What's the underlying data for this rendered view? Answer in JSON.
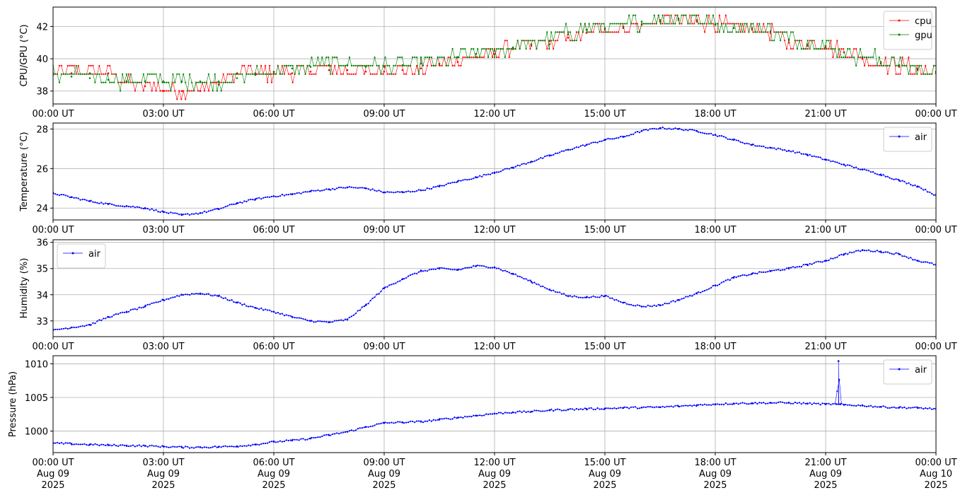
{
  "chart_data": [
    {
      "type": "line",
      "id": "cpu_gpu",
      "ylabel": "CPU/GPU (°C)",
      "xlim": [
        0,
        24
      ],
      "ylim": [
        37.2,
        43.2
      ],
      "yticks": [
        38,
        40,
        42
      ],
      "x_ticks": [
        0,
        3,
        6,
        9,
        12,
        15,
        18,
        21,
        24
      ],
      "x_tick_labels": [
        "00:00 UT",
        "03:00 UT",
        "06:00 UT",
        "09:00 UT",
        "12:00 UT",
        "15:00 UT",
        "18:00 UT",
        "21:00 UT",
        "00:00 UT"
      ],
      "grid": true,
      "legend": "top-right",
      "series": [
        {
          "name": "cpu",
          "color": "#ff0000",
          "marker": "dot",
          "x": [
            0,
            0.5,
            1,
            1.5,
            2,
            2.5,
            3,
            3.5,
            4,
            4.5,
            5,
            5.5,
            6,
            6.5,
            7,
            7.5,
            8,
            8.5,
            9,
            9.5,
            10,
            10.5,
            11,
            11.5,
            12,
            12.5,
            13,
            13.5,
            14,
            14.5,
            15,
            15.5,
            16,
            16.5,
            17,
            17.5,
            18,
            18.5,
            19,
            19.5,
            20,
            20.5,
            21,
            21.5,
            22,
            22.5,
            23,
            23.5,
            24
          ],
          "values": [
            39.1,
            39.1,
            39.1,
            39.1,
            38.6,
            38.3,
            38.0,
            38.0,
            38.0,
            38.4,
            39.1,
            39.1,
            39.1,
            39.1,
            39.2,
            39.3,
            39.3,
            39.2,
            39.2,
            39.3,
            39.4,
            39.6,
            39.8,
            40.1,
            40.3,
            40.6,
            40.8,
            40.9,
            41.3,
            41.6,
            41.8,
            41.9,
            42.1,
            42.3,
            42.4,
            42.3,
            42.1,
            41.9,
            41.8,
            41.6,
            41.0,
            40.8,
            40.7,
            40.4,
            40.0,
            39.7,
            39.5,
            39.3,
            39.1
          ]
        },
        {
          "name": "gpu",
          "color": "#008000",
          "marker": "dot",
          "x": [
            0,
            0.5,
            1,
            1.5,
            2,
            2.5,
            3,
            3.5,
            4,
            4.5,
            5,
            5.5,
            6,
            6.5,
            7,
            7.5,
            8,
            8.5,
            9,
            9.5,
            10,
            10.5,
            11,
            11.5,
            12,
            12.5,
            13,
            13.5,
            14,
            14.5,
            15,
            15.5,
            16,
            16.5,
            17,
            17.5,
            18,
            18.5,
            19,
            19.5,
            20,
            20.5,
            21,
            21.5,
            22,
            22.5,
            23,
            23.5,
            24
          ],
          "values": [
            39.0,
            38.9,
            38.8,
            38.7,
            38.6,
            38.6,
            38.6,
            38.6,
            38.6,
            38.6,
            38.8,
            39.0,
            39.2,
            39.4,
            39.5,
            39.6,
            39.6,
            39.5,
            39.5,
            39.6,
            39.7,
            39.7,
            40.1,
            40.3,
            40.5,
            40.7,
            40.9,
            41.1,
            41.5,
            41.8,
            41.9,
            42.0,
            42.3,
            42.4,
            42.5,
            42.4,
            42.1,
            41.9,
            41.9,
            41.7,
            41.2,
            40.9,
            40.8,
            40.4,
            40.1,
            39.8,
            39.6,
            39.4,
            39.2
          ]
        }
      ]
    },
    {
      "type": "line",
      "id": "temperature",
      "ylabel": "Temperature (°C)",
      "xlim": [
        0,
        24
      ],
      "ylim": [
        23.4,
        28.3
      ],
      "yticks": [
        24,
        26,
        28
      ],
      "x_ticks": [
        0,
        3,
        6,
        9,
        12,
        15,
        18,
        21,
        24
      ],
      "x_tick_labels": [
        "00:00 UT",
        "03:00 UT",
        "06:00 UT",
        "09:00 UT",
        "12:00 UT",
        "15:00 UT",
        "18:00 UT",
        "21:00 UT",
        "00:00 UT"
      ],
      "grid": true,
      "legend": "top-right",
      "series": [
        {
          "name": "air",
          "color": "#0000ff",
          "marker": "dot",
          "x": [
            0,
            0.5,
            1,
            1.5,
            2,
            2.5,
            3,
            3.5,
            4,
            4.5,
            5,
            5.5,
            6,
            6.5,
            7,
            7.5,
            8,
            8.5,
            9,
            9.5,
            10,
            10.5,
            11,
            11.5,
            12,
            12.5,
            13,
            13.5,
            14,
            14.5,
            15,
            15.5,
            16,
            16.5,
            17,
            17.5,
            18,
            18.5,
            19,
            19.5,
            20,
            20.5,
            21,
            21.5,
            22,
            22.5,
            23,
            23.5,
            24
          ],
          "values": [
            24.75,
            24.55,
            24.35,
            24.2,
            24.1,
            24.0,
            23.8,
            23.65,
            23.75,
            23.95,
            24.25,
            24.45,
            24.6,
            24.7,
            24.85,
            24.95,
            25.05,
            25.0,
            24.8,
            24.8,
            24.9,
            25.1,
            25.35,
            25.55,
            25.8,
            26.05,
            26.35,
            26.65,
            26.95,
            27.2,
            27.45,
            27.6,
            27.9,
            28.05,
            28.0,
            27.9,
            27.7,
            27.45,
            27.2,
            27.05,
            26.9,
            26.7,
            26.45,
            26.2,
            25.95,
            25.7,
            25.4,
            25.1,
            24.65
          ]
        }
      ]
    },
    {
      "type": "line",
      "id": "humidity",
      "ylabel": "Humidity (%)",
      "xlim": [
        0,
        24
      ],
      "ylim": [
        32.4,
        36.1
      ],
      "yticks": [
        33,
        34,
        35,
        36
      ],
      "x_ticks": [
        0,
        3,
        6,
        9,
        12,
        15,
        18,
        21,
        24
      ],
      "x_tick_labels": [
        "00:00 UT",
        "03:00 UT",
        "06:00 UT",
        "09:00 UT",
        "12:00 UT",
        "15:00 UT",
        "18:00 UT",
        "21:00 UT",
        "00:00 UT"
      ],
      "grid": true,
      "legend": "top-left",
      "series": [
        {
          "name": "air",
          "color": "#0000ff",
          "marker": "dot",
          "x": [
            0,
            0.5,
            1,
            1.5,
            2,
            2.5,
            3,
            3.5,
            4,
            4.5,
            5,
            5.5,
            6,
            6.5,
            7,
            7.5,
            8,
            8.5,
            9,
            9.5,
            10,
            10.5,
            11,
            11.5,
            12,
            12.5,
            13,
            13.5,
            14,
            14.5,
            15,
            15.5,
            16,
            16.5,
            17,
            17.5,
            18,
            18.5,
            19,
            19.5,
            20,
            20.5,
            21,
            21.5,
            22,
            22.5,
            23,
            23.5,
            24
          ],
          "values": [
            32.65,
            32.75,
            32.85,
            33.15,
            33.35,
            33.55,
            33.8,
            34.0,
            34.05,
            33.95,
            33.7,
            33.5,
            33.35,
            33.15,
            33.0,
            32.95,
            33.05,
            33.6,
            34.25,
            34.6,
            34.9,
            35.0,
            34.95,
            35.1,
            35.05,
            34.8,
            34.5,
            34.2,
            33.95,
            33.9,
            33.95,
            33.7,
            33.55,
            33.6,
            33.8,
            34.05,
            34.35,
            34.65,
            34.8,
            34.9,
            35.0,
            35.15,
            35.3,
            35.55,
            35.7,
            35.65,
            35.55,
            35.3,
            35.15
          ]
        }
      ]
    },
    {
      "type": "line",
      "id": "pressure",
      "ylabel": "Pressure (hPa)",
      "xlim": [
        0,
        24
      ],
      "ylim": [
        996.8,
        1011.2
      ],
      "yticks": [
        1000,
        1005,
        1010
      ],
      "x_ticks": [
        0,
        3,
        6,
        9,
        12,
        15,
        18,
        21,
        24
      ],
      "x_tick_labels": [
        [
          "00:00 UT",
          "Aug 09",
          "2025"
        ],
        [
          "03:00 UT",
          "Aug 09",
          "2025"
        ],
        [
          "06:00 UT",
          "Aug 09",
          "2025"
        ],
        [
          "09:00 UT",
          "Aug 09",
          "2025"
        ],
        [
          "12:00 UT",
          "Aug 09",
          "2025"
        ],
        [
          "15:00 UT",
          "Aug 09",
          "2025"
        ],
        [
          "18:00 UT",
          "Aug 09",
          "2025"
        ],
        [
          "21:00 UT",
          "Aug 09",
          "2025"
        ],
        [
          "00:00 UT",
          "Aug 10",
          "2025"
        ]
      ],
      "grid": true,
      "legend": "top-right",
      "series": [
        {
          "name": "air",
          "color": "#0000ff",
          "marker": "dot",
          "x": [
            0,
            0.5,
            1,
            1.5,
            2,
            2.5,
            3,
            3.5,
            4,
            4.5,
            5,
            5.5,
            6,
            6.5,
            7,
            7.5,
            8,
            8.5,
            9,
            9.5,
            10,
            10.5,
            11,
            11.5,
            12,
            12.5,
            13,
            13.5,
            14,
            14.5,
            15,
            15.5,
            16,
            16.5,
            17,
            17.5,
            18,
            18.5,
            19,
            19.5,
            20,
            20.5,
            21,
            21.3,
            21.35,
            21.4,
            21.5,
            22,
            22.5,
            23,
            23.5,
            24
          ],
          "values": [
            998.2,
            998.1,
            998.0,
            997.9,
            997.85,
            997.8,
            997.7,
            997.6,
            997.6,
            997.65,
            997.75,
            998.0,
            998.4,
            998.6,
            998.9,
            999.4,
            999.9,
            1000.6,
            1001.2,
            1001.3,
            1001.4,
            1001.7,
            1002.0,
            1002.3,
            1002.6,
            1002.8,
            1002.9,
            1003.1,
            1003.2,
            1003.3,
            1003.35,
            1003.45,
            1003.5,
            1003.55,
            1003.7,
            1003.85,
            1004.0,
            1004.1,
            1004.15,
            1004.2,
            1004.2,
            1004.1,
            1004.0,
            1004.0,
            1010.4,
            1004.0,
            1003.9,
            1003.8,
            1003.6,
            1003.5,
            1003.45,
            1003.3
          ]
        }
      ]
    }
  ]
}
